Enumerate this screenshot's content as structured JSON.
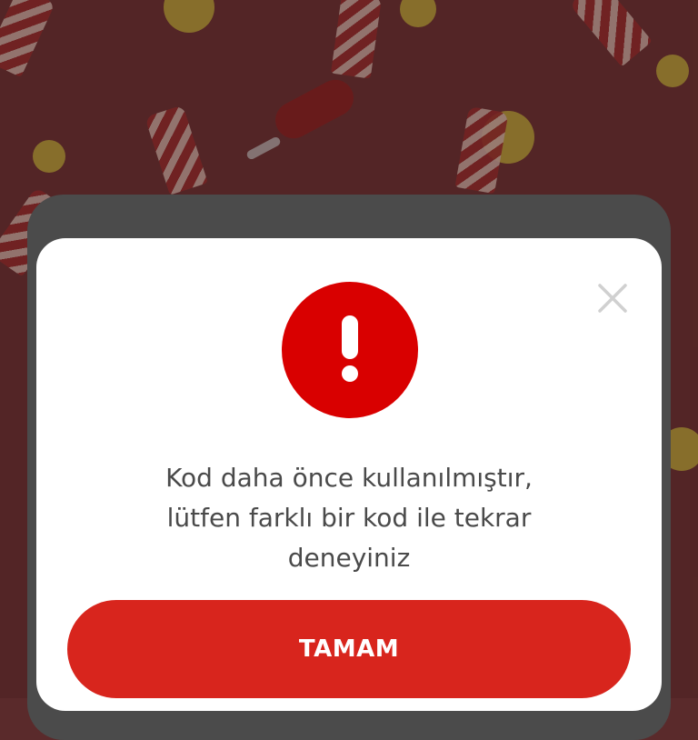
{
  "dialog": {
    "message_lines": [
      "Kod daha önce kullanılmıştır,",
      "lütfen farklı bir kod ile tekrar",
      "deneyiniz"
    ],
    "ok_label": "TAMAM",
    "icons": {
      "alert": "exclamation-icon",
      "close": "close-icon"
    }
  },
  "colors": {
    "accent": "#d8251d",
    "alert": "#d90000",
    "background": "#6b2f30"
  }
}
